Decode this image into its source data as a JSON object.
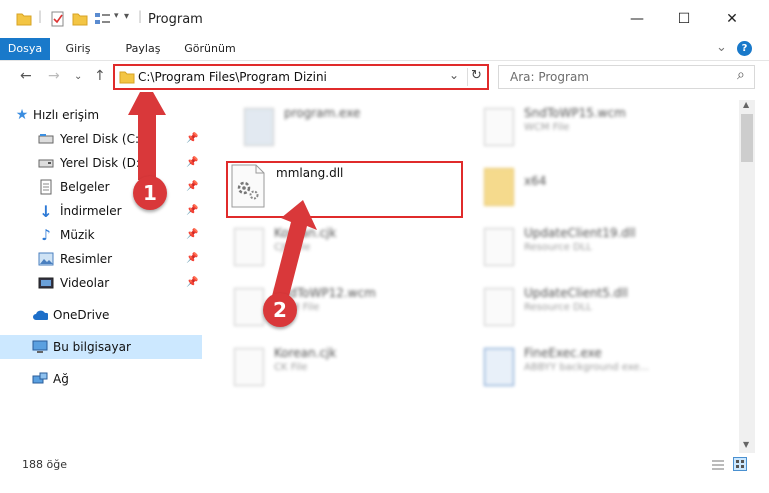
{
  "window": {
    "title": "Program",
    "minimize": "—",
    "maximize": "☐",
    "close": "✕"
  },
  "ribbon": {
    "tabs": [
      "Dosya",
      "Giriş",
      "Paylaş",
      "Görünüm"
    ],
    "expand": "⌄",
    "help": "?"
  },
  "nav": {
    "back": "←",
    "forward": "→",
    "history": "⌄",
    "up": "↑"
  },
  "address": {
    "path": "C:\\Program Files\\Program Dizini",
    "dropdown": "⌄",
    "refresh": "↻"
  },
  "search": {
    "placeholder": "Ara: Program",
    "icon": "⌕"
  },
  "sidebar": {
    "items": [
      {
        "label": "Hızlı erişim",
        "icon": "star-icon",
        "pinned": false
      },
      {
        "label": "Yerel Disk (C:)",
        "icon": "drive-icon",
        "pinned": true
      },
      {
        "label": "Yerel Disk (D:)",
        "icon": "drive-icon",
        "pinned": true
      },
      {
        "label": "Belgeler",
        "icon": "documents-icon",
        "pinned": true
      },
      {
        "label": "İndirmeler",
        "icon": "download-icon",
        "pinned": true
      },
      {
        "label": "Müzik",
        "icon": "music-icon",
        "pinned": true
      },
      {
        "label": "Resimler",
        "icon": "pictures-icon",
        "pinned": true
      },
      {
        "label": "Videolar",
        "icon": "videos-icon",
        "pinned": true
      },
      {
        "label": "OneDrive",
        "icon": "cloud-icon",
        "pinned": false
      },
      {
        "label": "Bu bilgisayar",
        "icon": "computer-icon",
        "pinned": false,
        "selected": true
      },
      {
        "label": "Ağ",
        "icon": "network-icon",
        "pinned": false
      }
    ]
  },
  "files": [
    {
      "name": "program.exe",
      "type": ""
    },
    {
      "name": "SndToWP15.wcm",
      "type": "WCM File"
    },
    {
      "name": "x64",
      "type": ""
    },
    {
      "name": "Korean.cjk",
      "type": "CJK File"
    },
    {
      "name": "UpdateClient19.dll",
      "type": "Resource DLL"
    },
    {
      "name": "SndToWP12.wcm",
      "type": "WCM File"
    },
    {
      "name": "UpdateClient5.dll",
      "type": "Resource DLL"
    },
    {
      "name": "Korean.cjk",
      "type": "CK File"
    },
    {
      "name": "FineExec.exe",
      "type": "ABBYY background exe..."
    }
  ],
  "highlighted_file": {
    "name": "mmlang.dll"
  },
  "status": {
    "item_count": "188 öğe"
  },
  "annotations": {
    "step1": "1",
    "step2": "2",
    "color": "#e02b2b"
  }
}
